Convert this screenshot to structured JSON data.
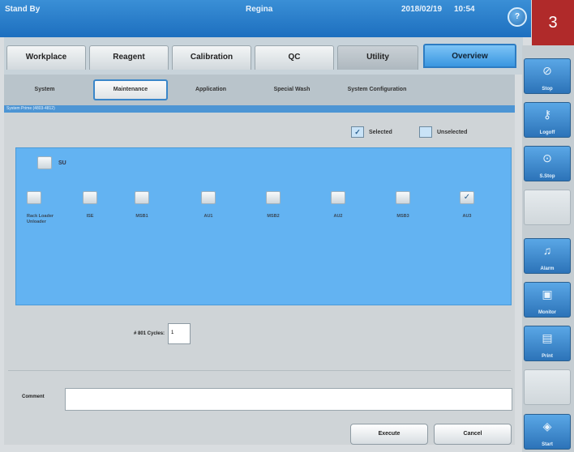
{
  "titlebar": {
    "status": "Stand By",
    "user": "Regina",
    "date": "2018/02/19",
    "time": "10:54",
    "help_label": "?"
  },
  "badge": "3",
  "main_tabs": [
    {
      "label": "Workplace",
      "active": false
    },
    {
      "label": "Reagent",
      "active": false
    },
    {
      "label": "Calibration",
      "active": false
    },
    {
      "label": "QC",
      "active": false
    },
    {
      "label": "Utility",
      "active": true
    },
    {
      "label": "Overview",
      "active": false
    }
  ],
  "sub_tabs": [
    {
      "label": "System",
      "active": false
    },
    {
      "label": "Maintenance",
      "active": true
    },
    {
      "label": "Application",
      "active": false
    },
    {
      "label": "Special Wash",
      "active": false
    },
    {
      "label": "System Configuration",
      "active": false
    }
  ],
  "path": "System Prime (4803-4812)",
  "legend": {
    "selected": "Selected",
    "unselected": "Unselected"
  },
  "su": {
    "label": "SU",
    "checked": false
  },
  "units": [
    {
      "label": "Rack Loader Unloader",
      "checked": false
    },
    {
      "label": "ISE",
      "checked": false
    },
    {
      "label": "MSB1",
      "checked": false
    },
    {
      "label": "AU1",
      "checked": false
    },
    {
      "label": "MSB2",
      "checked": false
    },
    {
      "label": "AU2",
      "checked": false
    },
    {
      "label": "MSB3",
      "checked": false
    },
    {
      "label": "AU3",
      "checked": true
    }
  ],
  "cycles": {
    "label": "# 801 Cycles:",
    "value": "1"
  },
  "comment": {
    "label": "Comment",
    "value": ""
  },
  "buttons": {
    "execute": "Execute",
    "cancel": "Cancel"
  },
  "sidebar": [
    {
      "label": "Stop",
      "icon": "stop-icon"
    },
    {
      "label": "Logoff",
      "icon": "key-icon"
    },
    {
      "label": "S.Stop",
      "icon": "sampling-stop-icon"
    },
    {
      "label": "Alarm",
      "icon": "bell-icon"
    },
    {
      "label": "Monitor",
      "icon": "monitor-icon"
    },
    {
      "label": "Print",
      "icon": "print-icon"
    },
    {
      "label": "Start",
      "icon": "start-icon"
    }
  ],
  "colors": {
    "accent": "#2c73b8",
    "panel": "#63b3f2",
    "badge": "#b02a2a"
  }
}
